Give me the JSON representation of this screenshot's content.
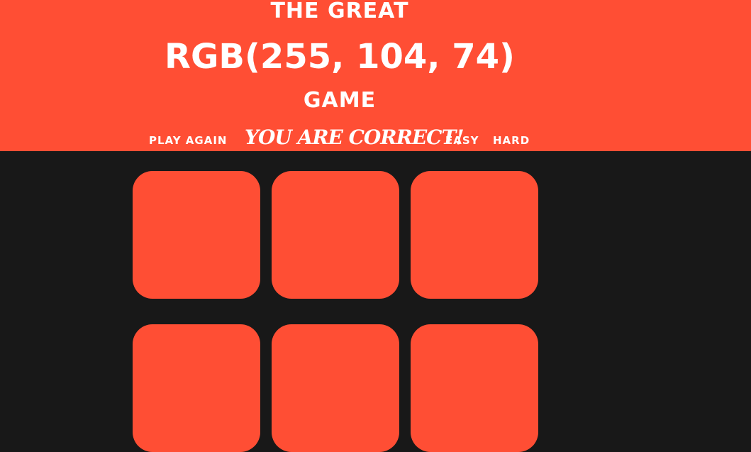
{
  "header": {
    "title_top": "THE GREAT",
    "rgb_text": "RGB(255, 104, 74)",
    "title_bottom": "GAME",
    "background_color": "#ff4e34"
  },
  "controls": {
    "play_again_label": "PLAY AGAIN",
    "message": "YOU ARE CORRECT!",
    "easy_label": "EASY",
    "hard_label": "HARD"
  },
  "board": {
    "background_color": "#181818",
    "square_colors": [
      "#ff4e34",
      "#ff4e34",
      "#ff4e34",
      "#ff4e34",
      "#ff4e34",
      "#ff4e34"
    ]
  }
}
